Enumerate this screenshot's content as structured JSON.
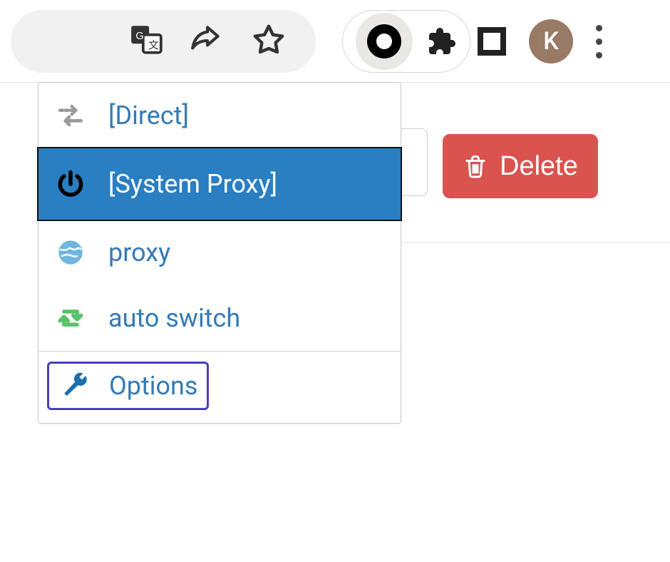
{
  "colors": {
    "link": "#337ab7",
    "selectedBg": "#2a7ec2",
    "danger": "#d9534f",
    "optionsBorder": "#4a3fbf",
    "avatarBg": "#997a65"
  },
  "toolbar": {
    "avatarInitial": "K"
  },
  "deleteButton": {
    "label": "Delete"
  },
  "menu": {
    "items": [
      {
        "label": "[Direct]",
        "icon": "arrows-swap"
      },
      {
        "label": "[System Proxy]",
        "icon": "power",
        "selected": true
      },
      {
        "label": "proxy",
        "icon": "globe"
      },
      {
        "label": "auto switch",
        "icon": "retweet"
      }
    ],
    "options": {
      "label": "Options",
      "icon": "wrench"
    }
  }
}
